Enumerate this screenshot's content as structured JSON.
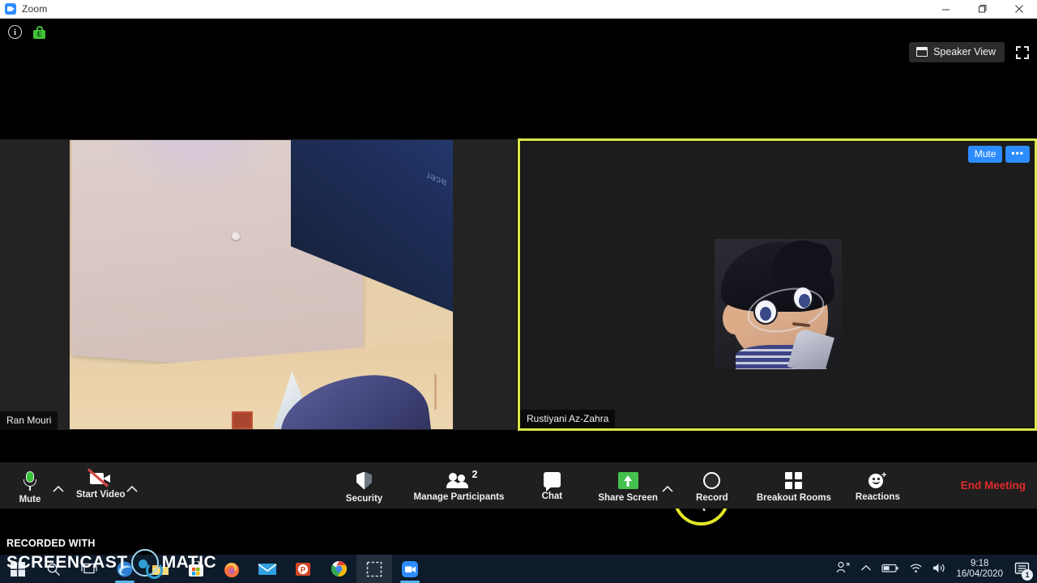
{
  "window": {
    "title": "Zoom",
    "app_icon": "zoom-logo-icon",
    "controls": {
      "minimize": "minimize-icon",
      "maximize": "maximize-icon",
      "close": "close-icon"
    }
  },
  "meeting_header": {
    "info_icon": "info-icon",
    "info_glyph": "i",
    "encryption_icon": "lock-icon",
    "encryption_glyph": "E",
    "view_button": {
      "label": "Speaker View",
      "icon": "speaker-view-icon"
    },
    "fullscreen_icon": "fullscreen-icon"
  },
  "participants": [
    {
      "name": "Ran Mouri",
      "tile": "video",
      "active_speaker": false,
      "acer_brand": "acer"
    },
    {
      "name": "Rustiyani Az-Zahra",
      "tile": "avatar",
      "active_speaker": true,
      "actions": {
        "mute_label": "Mute",
        "more_label": "•••"
      }
    }
  ],
  "toolbar": {
    "mute": {
      "label": "Mute",
      "icon": "microphone-icon",
      "state": "unmuted"
    },
    "mute_caret": "chevron-up-icon",
    "video": {
      "label": "Start Video",
      "icon": "camera-off-icon",
      "state": "stopped"
    },
    "video_caret": "chevron-up-icon",
    "security": {
      "label": "Security",
      "icon": "shield-icon"
    },
    "participants": {
      "label": "Manage Participants",
      "icon": "people-icon",
      "count": "2"
    },
    "chat": {
      "label": "Chat",
      "icon": "chat-bubble-icon"
    },
    "share": {
      "label": "Share Screen",
      "icon": "share-screen-icon"
    },
    "share_caret": "chevron-up-icon",
    "record": {
      "label": "Record",
      "icon": "record-circle-icon"
    },
    "breakout": {
      "label": "Breakout Rooms",
      "icon": "breakout-rooms-icon"
    },
    "reactions": {
      "label": "Reactions",
      "icon": "reactions-icon"
    },
    "end_meeting": {
      "label": "End Meeting",
      "color": "#e02b2b"
    }
  },
  "watermark": {
    "line1": "RECORDED WITH",
    "word1": "SCREENCAST",
    "word2": "MATIC",
    "logo": "screencast-o-matic-logo-icon"
  },
  "taskbar": {
    "items": [
      {
        "name": "start-button",
        "icon": "windows-logo-icon"
      },
      {
        "name": "search-button",
        "icon": "search-icon"
      },
      {
        "name": "task-view-button",
        "icon": "task-view-icon"
      },
      {
        "name": "edge-button",
        "icon": "edge-icon"
      },
      {
        "name": "file-explorer-button",
        "icon": "folder-icon"
      },
      {
        "name": "microsoft-store-button",
        "icon": "store-icon"
      },
      {
        "name": "firefox-button",
        "icon": "firefox-icon"
      },
      {
        "name": "mail-button",
        "icon": "mail-icon"
      },
      {
        "name": "powerpoint-button",
        "icon": "powerpoint-icon"
      },
      {
        "name": "chrome-button",
        "icon": "chrome-icon"
      },
      {
        "name": "snip-tool-button",
        "icon": "snip-icon"
      },
      {
        "name": "zoom-taskbar-button",
        "icon": "zoom-icon"
      }
    ],
    "tray": {
      "people_icon": "people-share-icon",
      "chevron_icon": "chevron-up-icon",
      "battery_icon": "battery-icon",
      "wifi_icon": "wifi-icon",
      "volume_icon": "volume-icon",
      "time": "9:18",
      "date": "16/04/2020",
      "notification_icon": "notification-icon",
      "notification_count": "1"
    }
  },
  "cursor": {
    "highlight_color": "#e3e827",
    "pointer": "mouse-pointer-icon"
  },
  "colors": {
    "accent_blue": "#2d8cff",
    "active_border": "#d8e84a",
    "end_meeting_red": "#e02b2b",
    "toolbar_bg": "#1f1f1f",
    "taskbar_bg": "#0e1b2a"
  }
}
